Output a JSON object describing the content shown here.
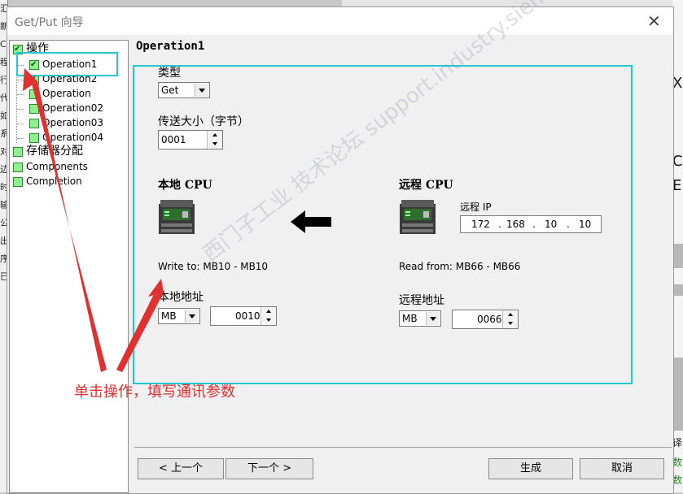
{
  "dialog": {
    "title": "Get/Put 向导",
    "close_glyph": "✕"
  },
  "tree": {
    "root_label": "操作",
    "operations": [
      "Operation1",
      "Operation2",
      "Operation",
      "Operation02",
      "Operation03",
      "Operation04"
    ],
    "memory_label": "存储器分配",
    "components_label": "Components",
    "completion_label": "Completion"
  },
  "main": {
    "heading": "Operation1",
    "type_label": "类型",
    "type_value": "Get",
    "size_label": "传送大小（字节）",
    "size_value": "0001",
    "local": {
      "title": "本地 CPU",
      "info": "Write to: MB10 - MB10",
      "address_label": "本地地址",
      "area_value": "MB",
      "offset_value": "0010"
    },
    "remote": {
      "title": "远程 CPU",
      "ip_label": "远程 IP",
      "ip": [
        "172",
        "168",
        "10",
        "10"
      ],
      "ip_sep": ".",
      "info": "Read from: MB66 - MB66",
      "address_label": "远程地址",
      "area_value": "MB",
      "offset_value": "0066"
    }
  },
  "footer": {
    "prev_label": "< 上一个",
    "next_label": "下一个 >",
    "generate_label": "生成",
    "cancel_label": "取消"
  },
  "annotation": {
    "text": "单击操作，填写通讯参数",
    "watermark": "西门子工业 技术论坛 support.industry.siemens.com/cs",
    "color_highlight": "#26c6d0",
    "color_arrow": "#e03030"
  },
  "background": {
    "left_chars": [
      "汇",
      "新",
      "CP",
      "程",
      "行",
      "代",
      "如",
      "系",
      "对",
      "边",
      "时",
      "输",
      "公",
      "出",
      "序",
      "已"
    ],
    "right_chars": [
      "X",
      "Cy",
      "E",
      "译",
      "数",
      "数"
    ]
  }
}
